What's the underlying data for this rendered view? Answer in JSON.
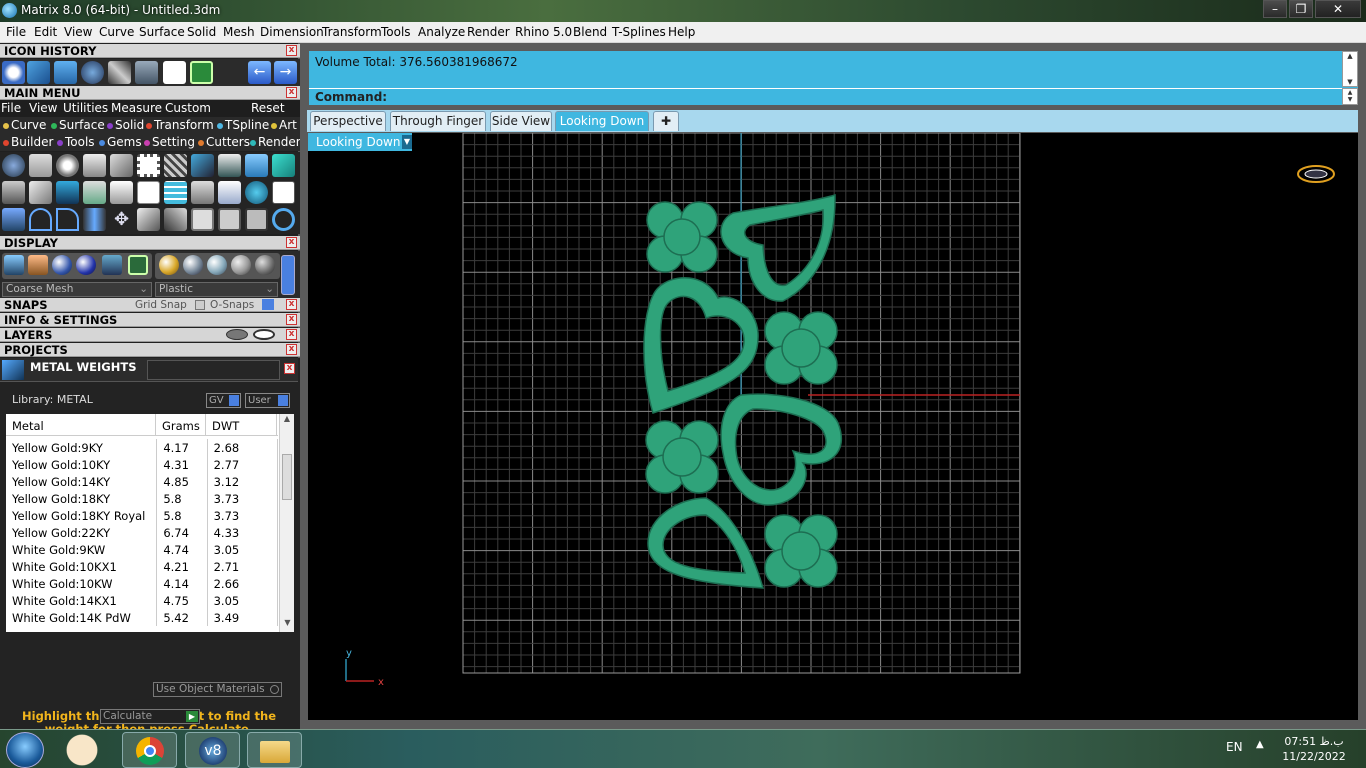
{
  "window": {
    "title": "Matrix 8.0 (64-bit) - Untitled.3dm"
  },
  "menubar": [
    "File",
    "Edit",
    "View",
    "Curve",
    "Surface",
    "Solid",
    "Mesh",
    "Dimension",
    "Transform",
    "Tools",
    "Analyze",
    "Render",
    "Rhino 5.0",
    "Blend",
    "T-Splines",
    "Help"
  ],
  "panels": {
    "icon_history": "ICON HISTORY",
    "main_menu": "MAIN MENU",
    "display": "DISPLAY",
    "snaps": "SNAPS",
    "grid_snap": "Grid Snap",
    "osnaps": "O-Snaps",
    "info": "INFO & SETTINGS",
    "layers": "LAYERS",
    "projects": "PROJECTS",
    "metal_weights": "METAL WEIGHTS"
  },
  "main_menu": {
    "top": [
      "File",
      "View",
      "Utilities",
      "Measure",
      "Custom"
    ],
    "reset": "Reset",
    "row1": [
      {
        "label": "Curve",
        "color": "#e6c24a"
      },
      {
        "label": "Surface",
        "color": "#2fb85a"
      },
      {
        "label": "Solid",
        "color": "#8a3fc9"
      },
      {
        "label": "Transform",
        "color": "#e0452e"
      },
      {
        "label": "TSpline",
        "color": "#4fb7e3"
      },
      {
        "label": "Art",
        "color": "#e0c23a"
      }
    ],
    "row2": [
      {
        "label": "Builder",
        "color": "#e0452e"
      },
      {
        "label": "Tools",
        "color": "#8a3fc9"
      },
      {
        "label": "Gems",
        "color": "#4a8ae0"
      },
      {
        "label": "Setting",
        "color": "#c93fb0"
      },
      {
        "label": "Cutters",
        "color": "#e07a2e"
      },
      {
        "label": "Render",
        "color": "#2fb8b8"
      }
    ]
  },
  "display": {
    "mesh": "Coarse Mesh",
    "material": "Plastic"
  },
  "metal": {
    "library": "Library: METAL",
    "gv": "GV",
    "user": "User",
    "headers": [
      "Metal",
      "Grams",
      "DWT"
    ],
    "rows": [
      [
        "Yellow Gold:9KY",
        "4.17",
        "2.68"
      ],
      [
        "Yellow Gold:10KY",
        "4.31",
        "2.77"
      ],
      [
        "Yellow Gold:14KY",
        "4.85",
        "3.12"
      ],
      [
        "Yellow Gold:18KY",
        "5.8",
        "3.73"
      ],
      [
        "Yellow Gold:18KY Royal",
        "5.8",
        "3.73"
      ],
      [
        "Yellow Gold:22KY",
        "6.74",
        "4.33"
      ],
      [
        "White Gold:9KW",
        "4.74",
        "3.05"
      ],
      [
        "White Gold:10KX1",
        "4.21",
        "2.71"
      ],
      [
        "White Gold:10KW",
        "4.14",
        "2.66"
      ],
      [
        "White Gold:14KX1",
        "4.75",
        "3.05"
      ],
      [
        "White Gold:14K PdW",
        "5.42",
        "3.49"
      ]
    ],
    "use_object": "Use Object Materials",
    "hint": "Highlight the item you want to find the weight for then press Calculate.",
    "calculate": "Calculate"
  },
  "command": {
    "output": "Volume Total: 376.560381968672",
    "prompt": "Command:"
  },
  "tabs": [
    "Perspective",
    "Through Finger",
    "Side View",
    "Looking Down"
  ],
  "active_tab": "Looking Down",
  "viewport_label": "Looking Down",
  "axes": {
    "x": "x",
    "y": "y"
  },
  "taskbar": {
    "lang": "EN",
    "time": "07:51 ب.ظ",
    "date": "11/22/2022"
  }
}
